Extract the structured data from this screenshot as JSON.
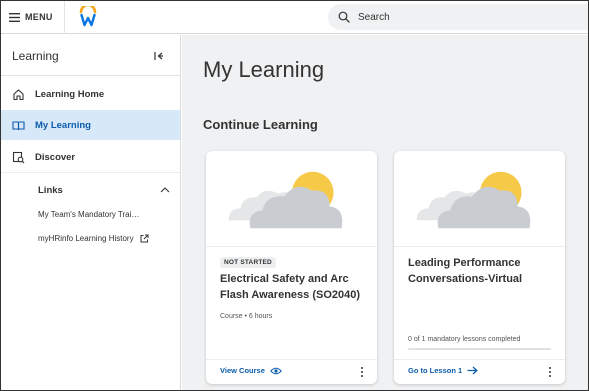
{
  "topbar": {
    "menu_label": "MENU",
    "logo_icon": "workday-logo",
    "search": {
      "placeholder": "Search",
      "icon": "search-icon"
    }
  },
  "sidebar": {
    "title": "Learning",
    "collapse_icon": "collapse-sidebar-icon",
    "items": [
      {
        "label": "Learning Home",
        "icon": "home-icon",
        "active": false
      },
      {
        "label": "My Learning",
        "icon": "book-icon",
        "active": true
      },
      {
        "label": "Discover",
        "icon": "discover-icon",
        "active": false
      }
    ],
    "links": {
      "heading": "Links",
      "expanded": true,
      "items": [
        {
          "label": "My Team's Mandatory Trai…",
          "external": false
        },
        {
          "label": "myHRinfo Learning History",
          "external": true
        }
      ]
    }
  },
  "main": {
    "page_title": "My Learning",
    "section_title": "Continue Learning",
    "cards": [
      {
        "badge": "NOT STARTED",
        "title": "Electrical Safety and Arc Flash Awareness (SO2040)",
        "meta": "Course • 6 hours",
        "action_label": "View Course",
        "action_icon": "eye-icon"
      },
      {
        "title": "Leading Performance Conversations-Virtual",
        "progress_text": "0 of 1 mandatory lessons completed",
        "progress": 0,
        "action_label": "Go to Lesson 1",
        "action_icon": "arrow-right-icon"
      }
    ]
  },
  "colors": {
    "accent": "#0b5cab",
    "active_bg": "#d7e8f9",
    "main_bg": "#f0f1f2",
    "sun": "#f7c948",
    "cloud": "#c9ccd1"
  }
}
